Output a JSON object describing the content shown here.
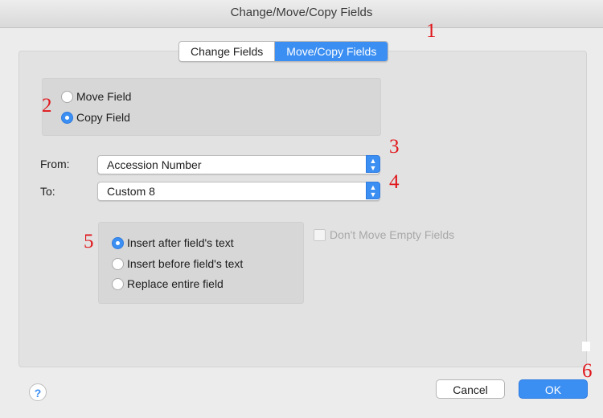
{
  "window": {
    "title": "Change/Move/Copy Fields"
  },
  "tabs": [
    {
      "label": "Change Fields",
      "active": false
    },
    {
      "label": "Move/Copy Fields",
      "active": true
    }
  ],
  "mode": {
    "options": [
      {
        "label": "Move Field",
        "selected": false
      },
      {
        "label": "Copy Field",
        "selected": true
      }
    ]
  },
  "from": {
    "label": "From:",
    "value": "Accession Number"
  },
  "to": {
    "label": "To:",
    "value": "Custom 8"
  },
  "insert": {
    "options": [
      {
        "label": "Insert after field's text",
        "selected": true
      },
      {
        "label": "Insert before field's text",
        "selected": false
      },
      {
        "label": "Replace entire field",
        "selected": false
      }
    ]
  },
  "dont_move_empty": {
    "label": "Don't Move Empty Fields",
    "checked": false,
    "enabled": false
  },
  "buttons": {
    "help": "?",
    "cancel": "Cancel",
    "ok": "OK"
  },
  "annotations": [
    "1",
    "2",
    "3",
    "4",
    "5",
    "6"
  ],
  "colors": {
    "accent": "#3c8ff2",
    "annotation": "#e0161b"
  }
}
